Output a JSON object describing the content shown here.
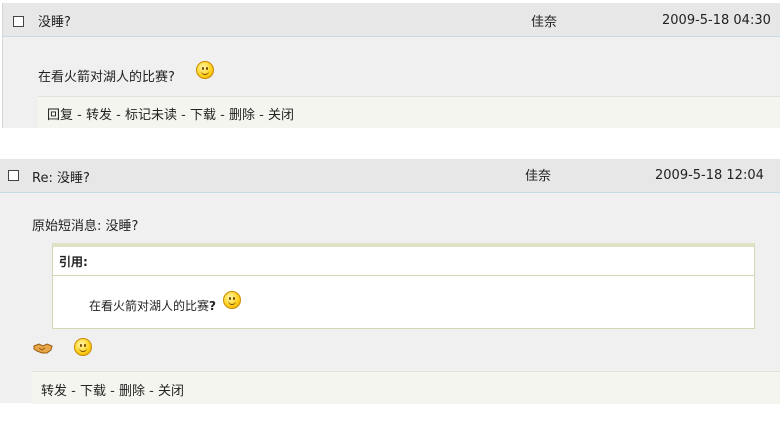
{
  "msg1": {
    "subject": "没睡?",
    "sender": "佳奈",
    "date": "2009-5-18 04:30",
    "body": "在看火箭对湖人的比赛?",
    "body_icon": "smile-icon",
    "actions": [
      "回复",
      "转发",
      "标记未读",
      "下载",
      "删除",
      "关闭"
    ]
  },
  "msg2": {
    "subject": "Re: 没睡?",
    "sender": "佳奈",
    "date": "2009-5-18 12:04",
    "original_label": "原始短消息: 没睡?",
    "quote_title": "引用:",
    "quote_text_prefix": "在看火箭对湖人的比赛",
    "quote_text_suffix": "?",
    "reply_icons": [
      "handshake-icon",
      "smile-icon"
    ],
    "actions": [
      "转发",
      "下载",
      "删除",
      "关闭"
    ]
  },
  "separator": "-"
}
